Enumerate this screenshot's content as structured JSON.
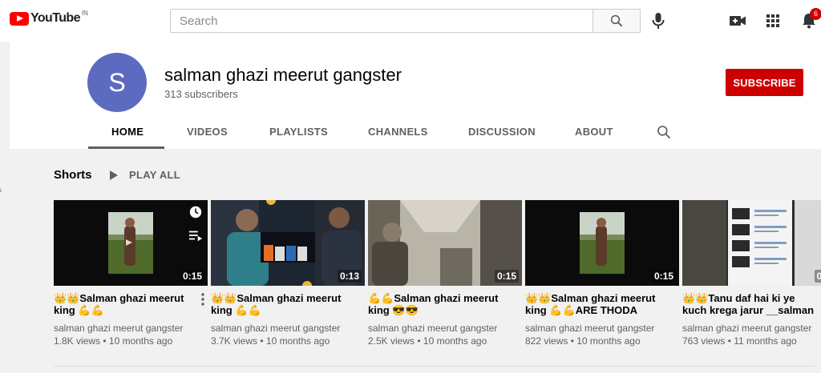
{
  "header": {
    "logo_text": "YouTube",
    "country": "IN",
    "search_placeholder": "Search",
    "notification_count": "6"
  },
  "channel": {
    "avatar_letter": "S",
    "name": "salman ghazi meerut gangster",
    "subscribers": "313 subscribers",
    "subscribe_label": "SUBSCRIBE"
  },
  "tabs": [
    "HOME",
    "VIDEOS",
    "PLAYLISTS",
    "CHANNELS",
    "DISCUSSION",
    "ABOUT"
  ],
  "sidebar_scrap": "s",
  "shelf": {
    "title": "Shorts",
    "play_all": "PLAY ALL"
  },
  "videos": [
    {
      "title": "👑👑Salman ghazi meerut king 💪💪",
      "channel": "salman ghazi meerut gangster",
      "stats": "1.8K views • 10 months ago",
      "duration": "0:15"
    },
    {
      "title": "👑👑Salman ghazi meerut king 💪💪",
      "channel": "salman ghazi meerut gangster",
      "stats": "3.7K views • 10 months ago",
      "duration": "0:13"
    },
    {
      "title": "💪💪Salman ghazi meerut king 😎😎",
      "channel": "salman ghazi meerut gangster",
      "stats": "2.5K views • 10 months ago",
      "duration": "0:15"
    },
    {
      "title": "👑👑Salman ghazi meerut king 💪💪ARE THODA SABAR…",
      "channel": "salman ghazi meerut gangster",
      "stats": "822 views • 10 months ago",
      "duration": "0:15"
    },
    {
      "title": "👑👑Tanu daf hai ki ye kuch krega jarur __salman ghazi…",
      "channel": "salman ghazi meerut gangster",
      "stats": "763 views • 11 months ago",
      "duration": "0:1"
    }
  ],
  "colors": {
    "brand_red": "#ff0000",
    "subscribe_red": "#cc0000",
    "avatar_bg": "#5c6bc0"
  }
}
